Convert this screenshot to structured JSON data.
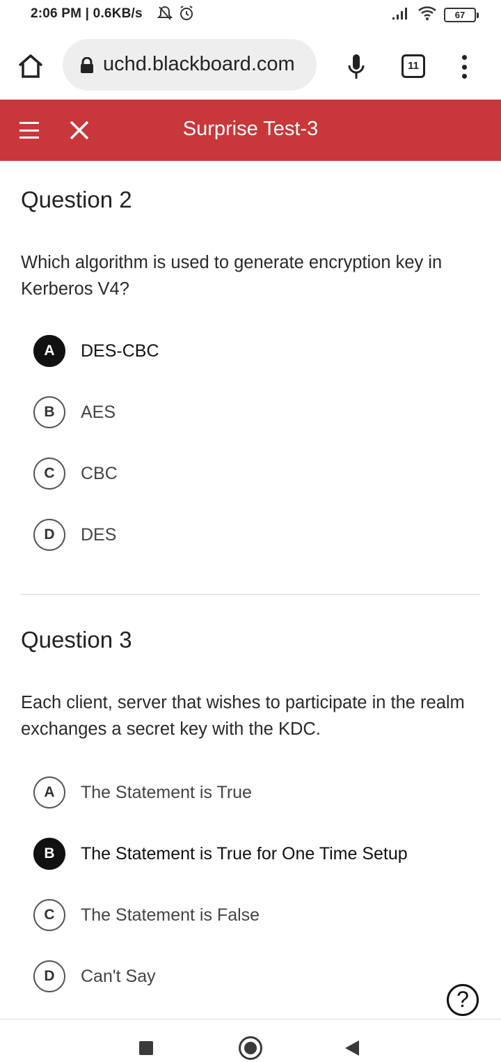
{
  "status_bar": {
    "time_speed": "2:06 PM | 0.6KB/s",
    "battery": "67",
    "icons": [
      "bell-off-icon",
      "alarm-icon",
      "signal-icon",
      "wifi-icon",
      "battery-icon"
    ]
  },
  "browser": {
    "url": "uchd.blackboard.com",
    "tab_count": "11",
    "icons": [
      "home-icon",
      "lock-icon",
      "mic-icon",
      "tabs-icon",
      "more-icon"
    ]
  },
  "header": {
    "title": "Surprise Test-3",
    "color": "#c8373a",
    "icons": [
      "menu-icon",
      "close-icon"
    ]
  },
  "questions": [
    {
      "title": "Question 2",
      "text": "Which algorithm is used to generate encryption key in Kerberos V4?",
      "options": [
        {
          "letter": "A",
          "text": "DES-CBC",
          "selected": true
        },
        {
          "letter": "B",
          "text": "AES",
          "selected": false
        },
        {
          "letter": "C",
          "text": "CBC",
          "selected": false
        },
        {
          "letter": "D",
          "text": "DES",
          "selected": false
        }
      ]
    },
    {
      "title": "Question 3",
      "text": "Each client, server that wishes to participate in the realm exchanges a secret key with the KDC.",
      "options": [
        {
          "letter": "A",
          "text": "The Statement is True",
          "selected": false
        },
        {
          "letter": "B",
          "text": "The Statement is True for One Time Setup",
          "selected": true
        },
        {
          "letter": "C",
          "text": "The Statement is False",
          "selected": false
        },
        {
          "letter": "D",
          "text": "Can't Say",
          "selected": false
        }
      ]
    }
  ],
  "help": {
    "label": "?"
  }
}
